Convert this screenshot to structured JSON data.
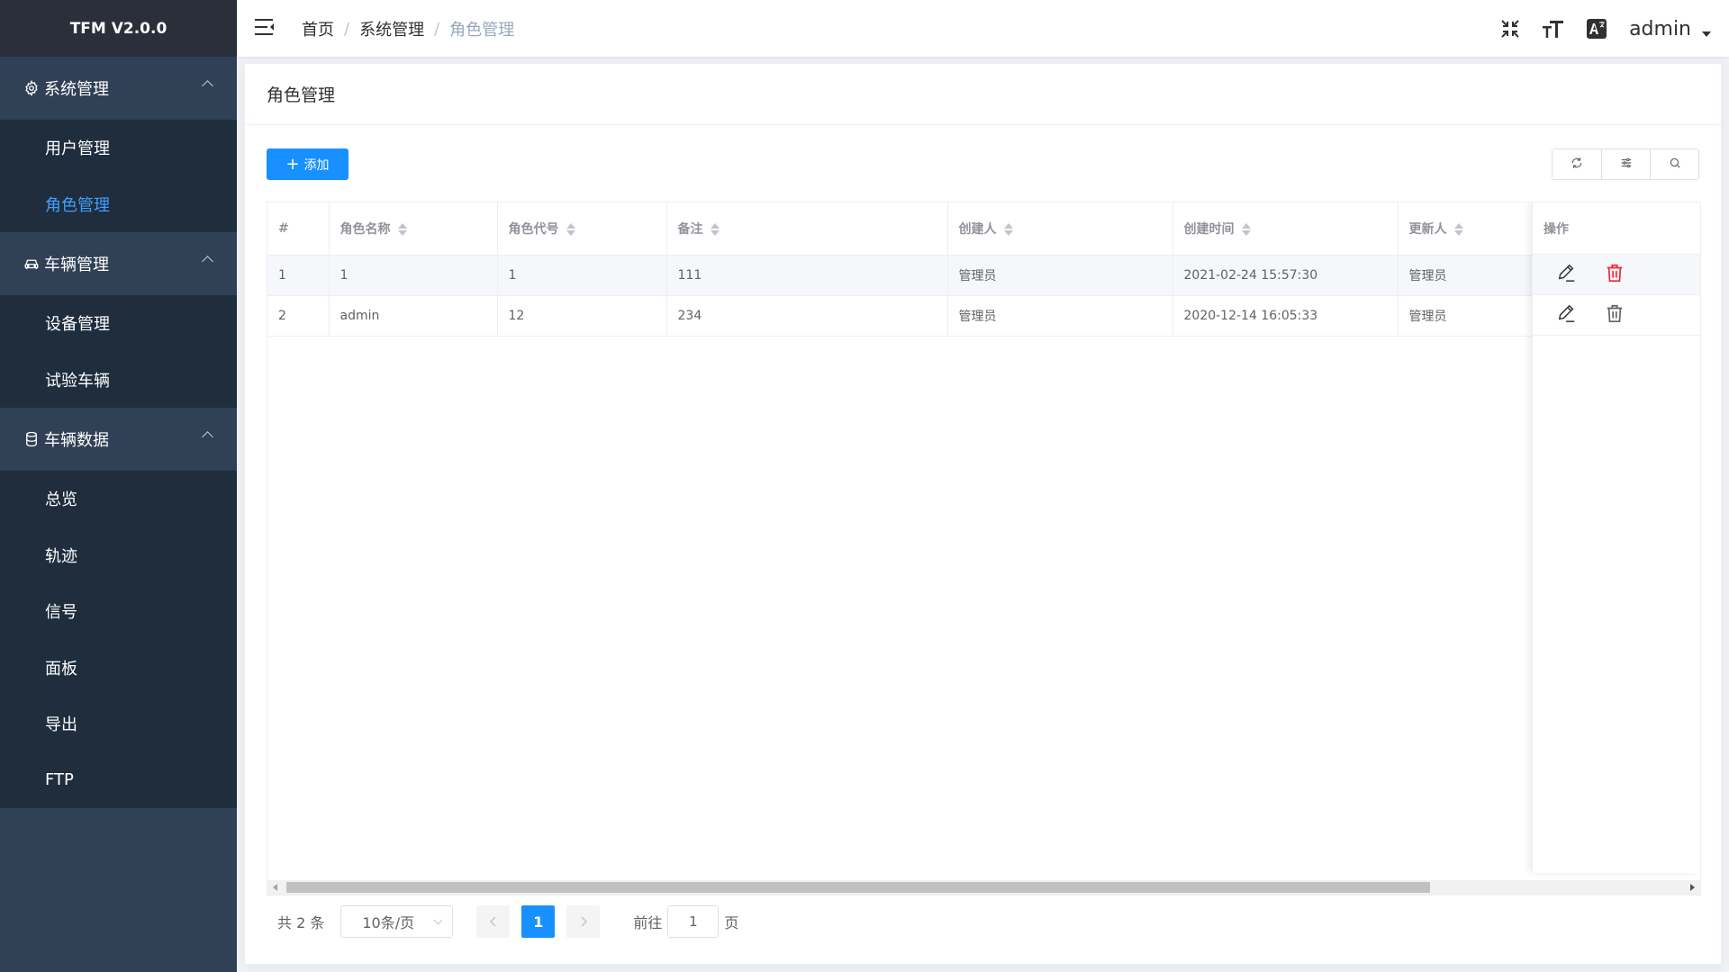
{
  "app": {
    "title": "TFM V2.0.0"
  },
  "sidebar": {
    "groups": [
      {
        "label": "系统管理",
        "icon": "gear-icon",
        "items": [
          {
            "label": "用户管理",
            "active": false
          },
          {
            "label": "角色管理",
            "active": true
          }
        ]
      },
      {
        "label": "车辆管理",
        "icon": "car-icon",
        "items": [
          {
            "label": "设备管理"
          },
          {
            "label": "试验车辆"
          }
        ]
      },
      {
        "label": "车辆数据",
        "icon": "database-icon",
        "items": [
          {
            "label": "总览"
          },
          {
            "label": "轨迹"
          },
          {
            "label": "信号"
          },
          {
            "label": "面板"
          },
          {
            "label": "导出"
          },
          {
            "label": "FTP"
          }
        ]
      }
    ]
  },
  "header": {
    "breadcrumb": [
      "首页",
      "系统管理",
      "角色管理"
    ],
    "breadcrumb_sep": "/",
    "username": "admin"
  },
  "page": {
    "title": "角色管理",
    "add_label": "添加"
  },
  "table": {
    "columns": [
      "#",
      "角色名称",
      "角色代号",
      "备注",
      "创建人",
      "创建时间",
      "更新人"
    ],
    "actions_header": "操作",
    "rows": [
      [
        "1",
        "1",
        "1",
        "111",
        "管理员",
        "2021-02-24 15:57:30",
        "管理员"
      ],
      [
        "2",
        "admin",
        "12",
        "234",
        "管理员",
        "2020-12-14 16:05:33",
        "管理员"
      ]
    ]
  },
  "pagination": {
    "total_text": "共 2 条",
    "page_size": "10条/页",
    "current_page": "1",
    "goto_label": "前往",
    "goto_value": "1",
    "page_suffix": "页"
  },
  "colors": {
    "primary": "#1890ff",
    "sidebar_bg": "#304156",
    "submenu_bg": "#1f2d3d",
    "active_text": "#409eff",
    "danger": "#f5222d"
  }
}
